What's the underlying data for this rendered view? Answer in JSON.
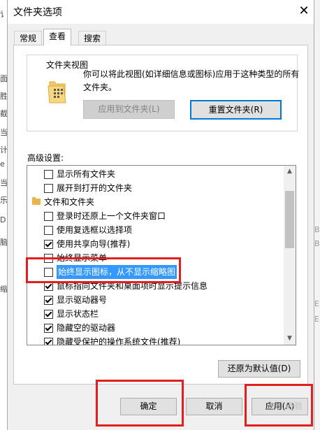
{
  "background": {
    "left_chars": [
      "讠",
      "面",
      "胜",
      "截",
      "当",
      "计",
      "e",
      "当",
      "乐",
      "D",
      "脑",
      "缩"
    ],
    "right_chars": [
      "B",
      "B",
      "E",
      "E"
    ]
  },
  "dialog": {
    "title": "文件夹选项",
    "close_glyph": "✕",
    "tabs": [
      "常规",
      "查看",
      "搜索"
    ],
    "active_tab": "查看",
    "folder_views": {
      "title": "文件夹视图",
      "description": "你可以将此视图(如详细信息或图标)应用于这种类型的所有文件夹。",
      "apply_button": "应用到文件夹(L)",
      "reset_button": "重置文件夹(R)"
    },
    "advanced_label": "高级设置:",
    "tree_items": [
      {
        "label": "显示所有文件夹",
        "type": "checkbox",
        "checked": false
      },
      {
        "label": "展开到打开的文件夹",
        "type": "checkbox",
        "checked": false
      },
      {
        "label": "文件和文件夹",
        "type": "folder"
      },
      {
        "label": "登录时还原上一个文件夹窗口",
        "type": "checkbox",
        "checked": false
      },
      {
        "label": "使用复选框以选择项",
        "type": "checkbox",
        "checked": false
      },
      {
        "label": "使用共享向导(推荐)",
        "type": "checkbox",
        "checked": true
      },
      {
        "label": "始终显示菜单",
        "type": "checkbox",
        "checked": false
      },
      {
        "label": "始终显示图标，从不显示缩略图",
        "type": "checkbox",
        "checked": false,
        "selected": true
      },
      {
        "label": "鼠标指向文件夹和桌面项时显示提示信息",
        "type": "checkbox",
        "checked": true
      },
      {
        "label": "显示驱动器号",
        "type": "checkbox",
        "checked": true
      },
      {
        "label": "显示状态栏",
        "type": "checkbox",
        "checked": true
      },
      {
        "label": "隐藏空的驱动器",
        "type": "checkbox",
        "checked": true
      },
      {
        "label": "隐藏受保护的操作系统文件(推荐)",
        "type": "checkbox",
        "checked": true
      }
    ],
    "restore_defaults": "还原为默认值(D)",
    "ok": "确定",
    "cancel": "取消",
    "apply": "应用(A)"
  },
  "watermark": "Bai 经验",
  "colors": {
    "highlight_red": "#e21e1e",
    "selection_blue": "#3399ff",
    "accent": "#0078d7"
  }
}
